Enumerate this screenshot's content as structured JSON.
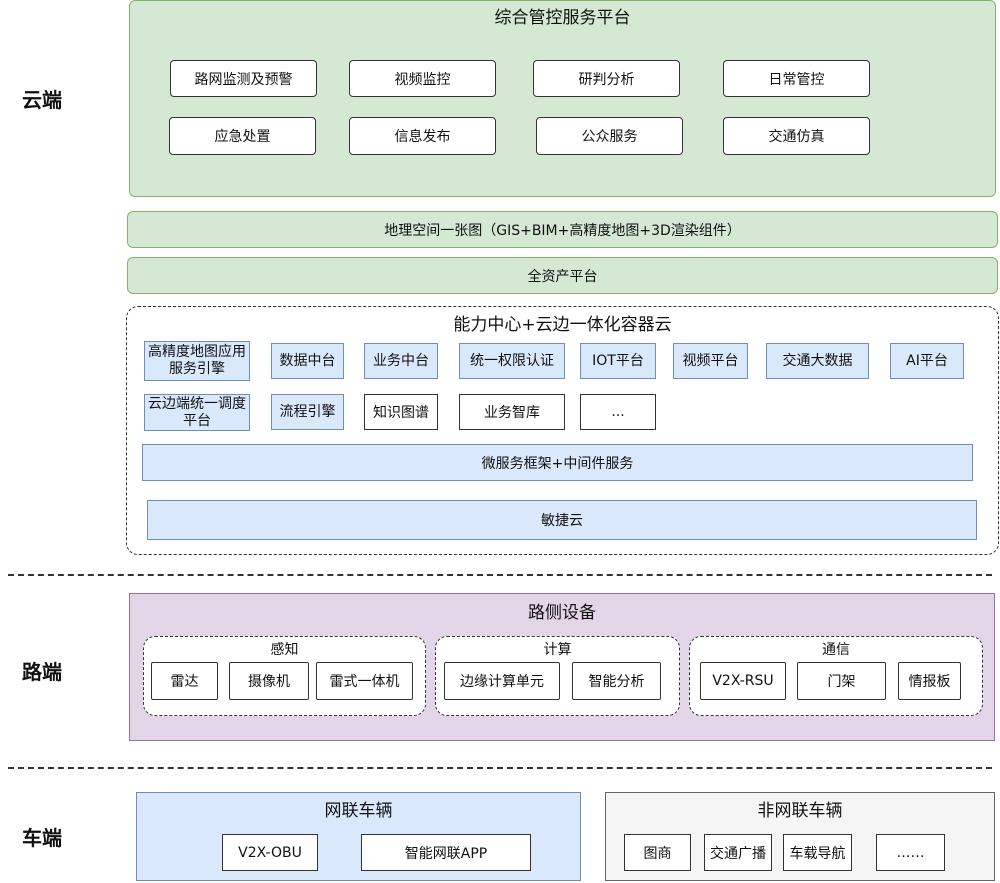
{
  "tiers": {
    "cloud": "云端",
    "road": "路端",
    "vehicle": "车端"
  },
  "cloud": {
    "platform_title": "综合管控服务平台",
    "platform_items": [
      "路网监测及预警",
      "视频监控",
      "研判分析",
      "日常管控",
      "应急处置",
      "信息发布",
      "公众服务",
      "交通仿真"
    ],
    "gis_bar": "地理空间一张图（GIS+BIM+高精度地图+3D渲染组件）",
    "asset_bar": "全资产平台",
    "capability_title": "能力中心+云边一体化容器云",
    "capability_items": [
      "高精度地图应用服务引擎",
      "数据中台",
      "业务中台",
      "统一权限认证",
      "IOT平台",
      "视频平台",
      "交通大数据",
      "AI平台",
      "云边端统一调度平台",
      "流程引擎",
      "知识图谱",
      "业务智库",
      "..."
    ],
    "micro_bar": "微服务框架+中间件服务",
    "agile_bar": "敏捷云"
  },
  "road": {
    "title": "路侧设备",
    "groups": [
      {
        "title": "感知",
        "items": [
          "雷达",
          "摄像机",
          "雷式一体机"
        ]
      },
      {
        "title": "计算",
        "items": [
          "边缘计算单元",
          "智能分析"
        ]
      },
      {
        "title": "通信",
        "items": [
          "V2X-RSU",
          "门架",
          "情报板"
        ]
      }
    ]
  },
  "vehicle": {
    "connected": {
      "title": "网联车辆",
      "items": [
        "V2X-OBU",
        "智能网联APP"
      ]
    },
    "non_connected": {
      "title": "非网联车辆",
      "items": [
        "图商",
        "交通广播",
        "车载导航",
        "……"
      ]
    }
  },
  "colors": {
    "green_fill": "#d5e8d4",
    "green_stroke": "#82b366",
    "purple_fill": "#e1d5e7",
    "blue_fill": "#dae8fc",
    "grey_fill": "#f5f5f5"
  }
}
